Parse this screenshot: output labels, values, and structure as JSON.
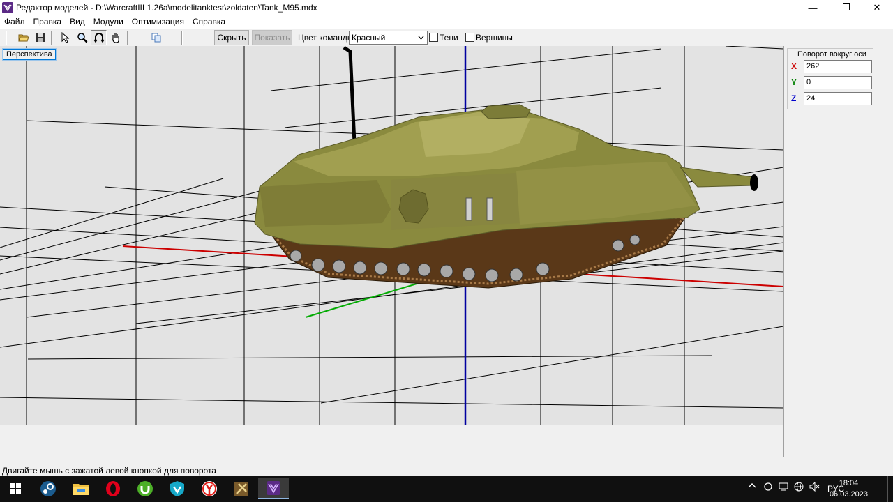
{
  "window": {
    "title": "Редактор моделей - D:\\WarcraftIII 1.26a\\modelitanktest\\zoldaten\\Tank_M95.mdx",
    "minimize_glyph": "—",
    "restore_glyph": "❐",
    "close_glyph": "✕"
  },
  "menu": {
    "items": [
      "Файл",
      "Правка",
      "Вид",
      "Модули",
      "Оптимизация",
      "Справка"
    ]
  },
  "toolbar": {
    "hide_label": "Скрыть",
    "show_label": "Показать",
    "team_color_label": "Цвет команды:",
    "team_color_value": "Красный",
    "shadows_label": "Тени",
    "vertices_label": "Вершины"
  },
  "viewport": {
    "view_label": "Перспектива",
    "background": "#e3e3e3",
    "x_axis_color": "#cc0000",
    "y_axis_color": "#00aa00",
    "z_axis_color": "#0000a0"
  },
  "rotation_panel": {
    "title": "Поворот вокруг оси",
    "x_label": "X",
    "y_label": "Y",
    "z_label": "Z",
    "x_value": "262",
    "y_value": "0",
    "z_value": "24",
    "x_color": "#cc0000",
    "y_color": "#008000",
    "z_color": "#0000cc"
  },
  "status_bar": {
    "text": "Двигайте мышь с зажатой левой кнопкой для поворота"
  },
  "taskbar": {
    "language": "РУС",
    "time": "18:04",
    "date": "06.03.2023",
    "apps": [
      "windows-start",
      "steam",
      "file-explorer",
      "opera",
      "utorrent",
      "vpn",
      "yandex-browser",
      "warcraft",
      "model-editor"
    ]
  }
}
